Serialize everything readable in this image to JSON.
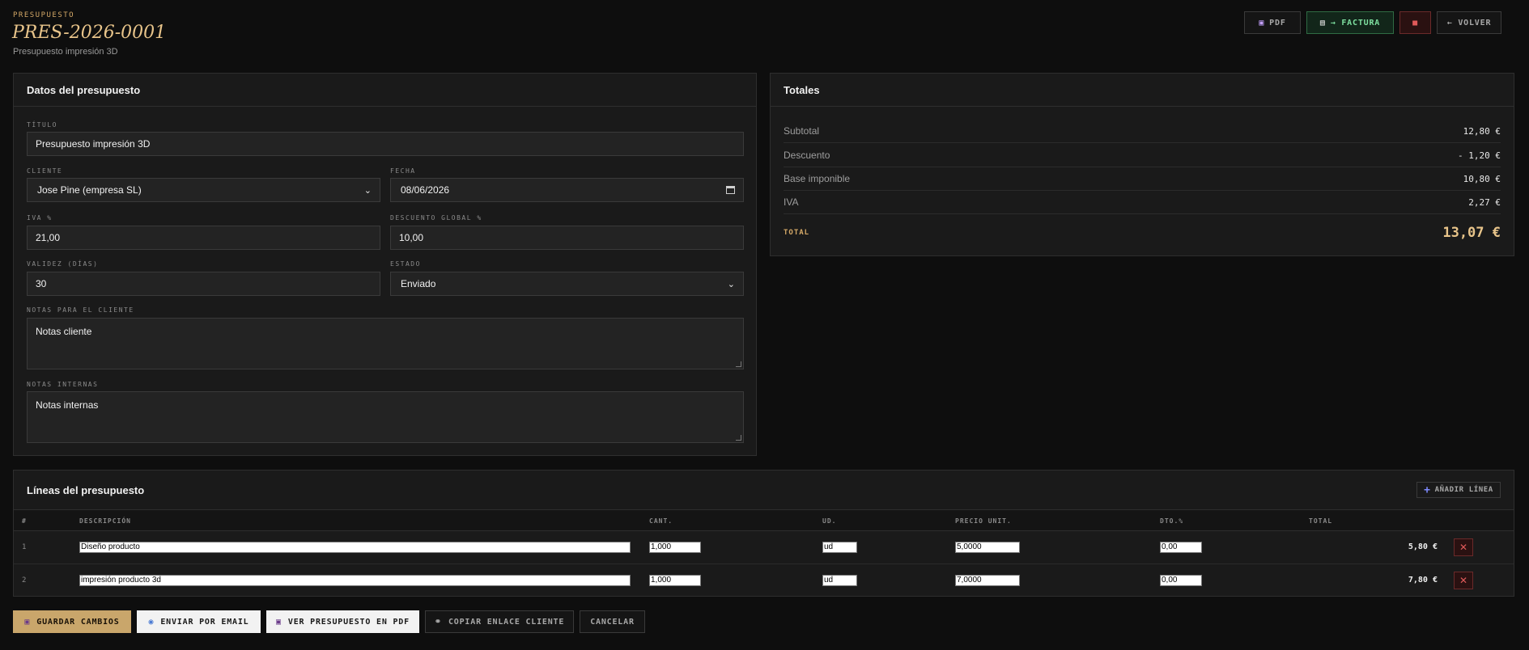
{
  "header": {
    "kicker": "PRESUPUESTO",
    "code": "PRES-2026-0001",
    "subtitle": "Presupuesto impresión 3D",
    "actions": {
      "pdf": "PDF",
      "factura": "→ FACTURA",
      "volver": "← VOLVER"
    }
  },
  "datos": {
    "heading": "Datos del presupuesto",
    "titulo_label": "TÍTULO",
    "titulo_value": "Presupuesto impresión 3D",
    "cliente_label": "CLIENTE",
    "cliente_value": "Jose Pine (empresa SL)",
    "fecha_label": "FECHA",
    "fecha_value": "08/06/2026",
    "iva_label": "IVA %",
    "iva_value": "21,00",
    "descuento_label": "DESCUENTO GLOBAL %",
    "descuento_value": "10,00",
    "validez_label": "VALIDEZ (DÍAS)",
    "validez_value": "30",
    "estado_label": "ESTADO",
    "estado_value": "Enviado",
    "notas_cliente_label": "NOTAS PARA EL CLIENTE",
    "notas_cliente_value": "Notas cliente",
    "notas_internas_label": "NOTAS INTERNAS",
    "notas_internas_value": "Notas internas"
  },
  "totales": {
    "heading": "Totales",
    "rows": [
      {
        "label": "Subtotal",
        "value": "12,80 €"
      },
      {
        "label": "Descuento",
        "value": "- 1,20 €"
      },
      {
        "label": "Base imponible",
        "value": "10,80 €"
      },
      {
        "label": "IVA",
        "value": "2,27 €"
      }
    ],
    "total_label": "TOTAL",
    "total_value": "13,07 €"
  },
  "lineas": {
    "heading": "Líneas del presupuesto",
    "add_label": "AÑADIR LÍNEA",
    "columns": [
      "#",
      "DESCRIPCIÓN",
      "CANT.",
      "UD.",
      "PRECIO UNIT.",
      "DTO.%",
      "TOTAL"
    ],
    "rows": [
      {
        "num": "1",
        "descripcion": "Diseño producto",
        "cant": "1,000",
        "ud": "ud",
        "precio": "5,0000",
        "dto": "0,00",
        "total": "5,80 €"
      },
      {
        "num": "2",
        "descripcion": "impresión producto 3d",
        "cant": "1,000",
        "ud": "ud",
        "precio": "7,0000",
        "dto": "0,00",
        "total": "7,80 €"
      }
    ]
  },
  "bottom": {
    "save": "GUARDAR CAMBIOS",
    "email": "ENVIAR POR EMAIL",
    "pdf": "VER PRESUPUESTO EN PDF",
    "link": "COPIAR ENLACE CLIENTE",
    "cancel": "CANCELAR"
  },
  "colors": {
    "accent": "#d4a867",
    "title": "#e8c48a",
    "success": "#7ee0a0",
    "danger": "#e05a5a"
  }
}
